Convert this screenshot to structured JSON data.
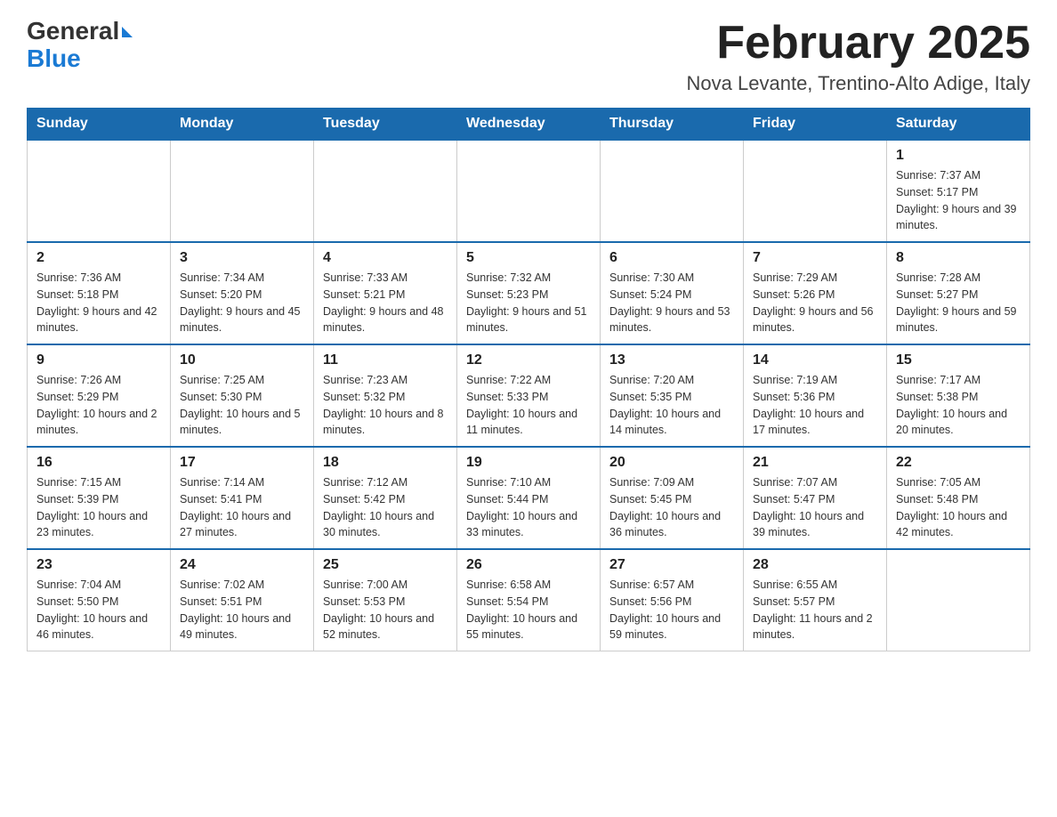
{
  "header": {
    "logo": {
      "general": "General",
      "blue": "Blue",
      "alt": "GeneralBlue logo"
    },
    "title": "February 2025",
    "location": "Nova Levante, Trentino-Alto Adige, Italy"
  },
  "calendar": {
    "days_of_week": [
      "Sunday",
      "Monday",
      "Tuesday",
      "Wednesday",
      "Thursday",
      "Friday",
      "Saturday"
    ],
    "weeks": [
      [
        {
          "day": "",
          "info": ""
        },
        {
          "day": "",
          "info": ""
        },
        {
          "day": "",
          "info": ""
        },
        {
          "day": "",
          "info": ""
        },
        {
          "day": "",
          "info": ""
        },
        {
          "day": "",
          "info": ""
        },
        {
          "day": "1",
          "info": "Sunrise: 7:37 AM\nSunset: 5:17 PM\nDaylight: 9 hours and 39 minutes."
        }
      ],
      [
        {
          "day": "2",
          "info": "Sunrise: 7:36 AM\nSunset: 5:18 PM\nDaylight: 9 hours and 42 minutes."
        },
        {
          "day": "3",
          "info": "Sunrise: 7:34 AM\nSunset: 5:20 PM\nDaylight: 9 hours and 45 minutes."
        },
        {
          "day": "4",
          "info": "Sunrise: 7:33 AM\nSunset: 5:21 PM\nDaylight: 9 hours and 48 minutes."
        },
        {
          "day": "5",
          "info": "Sunrise: 7:32 AM\nSunset: 5:23 PM\nDaylight: 9 hours and 51 minutes."
        },
        {
          "day": "6",
          "info": "Sunrise: 7:30 AM\nSunset: 5:24 PM\nDaylight: 9 hours and 53 minutes."
        },
        {
          "day": "7",
          "info": "Sunrise: 7:29 AM\nSunset: 5:26 PM\nDaylight: 9 hours and 56 minutes."
        },
        {
          "day": "8",
          "info": "Sunrise: 7:28 AM\nSunset: 5:27 PM\nDaylight: 9 hours and 59 minutes."
        }
      ],
      [
        {
          "day": "9",
          "info": "Sunrise: 7:26 AM\nSunset: 5:29 PM\nDaylight: 10 hours and 2 minutes."
        },
        {
          "day": "10",
          "info": "Sunrise: 7:25 AM\nSunset: 5:30 PM\nDaylight: 10 hours and 5 minutes."
        },
        {
          "day": "11",
          "info": "Sunrise: 7:23 AM\nSunset: 5:32 PM\nDaylight: 10 hours and 8 minutes."
        },
        {
          "day": "12",
          "info": "Sunrise: 7:22 AM\nSunset: 5:33 PM\nDaylight: 10 hours and 11 minutes."
        },
        {
          "day": "13",
          "info": "Sunrise: 7:20 AM\nSunset: 5:35 PM\nDaylight: 10 hours and 14 minutes."
        },
        {
          "day": "14",
          "info": "Sunrise: 7:19 AM\nSunset: 5:36 PM\nDaylight: 10 hours and 17 minutes."
        },
        {
          "day": "15",
          "info": "Sunrise: 7:17 AM\nSunset: 5:38 PM\nDaylight: 10 hours and 20 minutes."
        }
      ],
      [
        {
          "day": "16",
          "info": "Sunrise: 7:15 AM\nSunset: 5:39 PM\nDaylight: 10 hours and 23 minutes."
        },
        {
          "day": "17",
          "info": "Sunrise: 7:14 AM\nSunset: 5:41 PM\nDaylight: 10 hours and 27 minutes."
        },
        {
          "day": "18",
          "info": "Sunrise: 7:12 AM\nSunset: 5:42 PM\nDaylight: 10 hours and 30 minutes."
        },
        {
          "day": "19",
          "info": "Sunrise: 7:10 AM\nSunset: 5:44 PM\nDaylight: 10 hours and 33 minutes."
        },
        {
          "day": "20",
          "info": "Sunrise: 7:09 AM\nSunset: 5:45 PM\nDaylight: 10 hours and 36 minutes."
        },
        {
          "day": "21",
          "info": "Sunrise: 7:07 AM\nSunset: 5:47 PM\nDaylight: 10 hours and 39 minutes."
        },
        {
          "day": "22",
          "info": "Sunrise: 7:05 AM\nSunset: 5:48 PM\nDaylight: 10 hours and 42 minutes."
        }
      ],
      [
        {
          "day": "23",
          "info": "Sunrise: 7:04 AM\nSunset: 5:50 PM\nDaylight: 10 hours and 46 minutes."
        },
        {
          "day": "24",
          "info": "Sunrise: 7:02 AM\nSunset: 5:51 PM\nDaylight: 10 hours and 49 minutes."
        },
        {
          "day": "25",
          "info": "Sunrise: 7:00 AM\nSunset: 5:53 PM\nDaylight: 10 hours and 52 minutes."
        },
        {
          "day": "26",
          "info": "Sunrise: 6:58 AM\nSunset: 5:54 PM\nDaylight: 10 hours and 55 minutes."
        },
        {
          "day": "27",
          "info": "Sunrise: 6:57 AM\nSunset: 5:56 PM\nDaylight: 10 hours and 59 minutes."
        },
        {
          "day": "28",
          "info": "Sunrise: 6:55 AM\nSunset: 5:57 PM\nDaylight: 11 hours and 2 minutes."
        },
        {
          "day": "",
          "info": ""
        }
      ]
    ]
  }
}
